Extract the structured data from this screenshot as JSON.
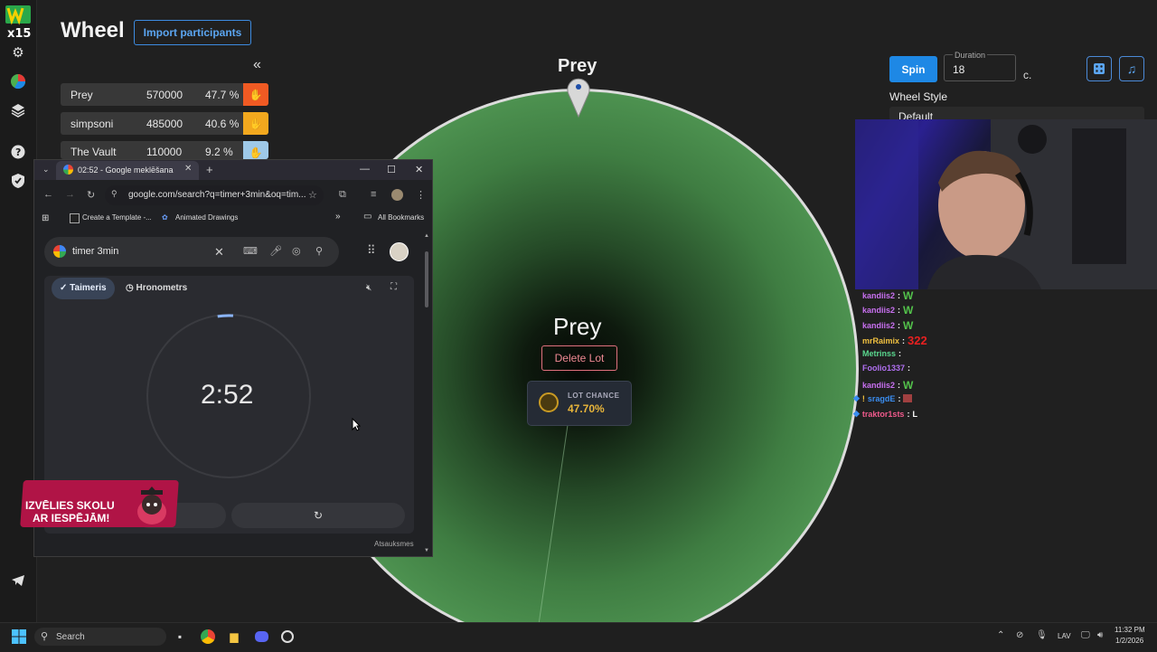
{
  "app": {
    "title": "Wheel",
    "import_label": "Import participants",
    "collapse_icon": "«"
  },
  "lots": [
    {
      "name": "Prey",
      "amount": "570000",
      "percent": "47.7 %",
      "color": "#f05a23"
    },
    {
      "name": "simpsoni",
      "amount": "485000",
      "percent": "40.6 %",
      "color": "#f2a81e"
    },
    {
      "name": "The Vault",
      "amount": "110000",
      "percent": "9.2 %",
      "color": "#9ec9e8"
    }
  ],
  "wheel": {
    "top_label": "Prey",
    "center_name": "Prey",
    "delete_label": "Delete Lot",
    "chance_label": "LOT CHANCE",
    "chance_value": "47.70%",
    "segment_color": "#5aa55d"
  },
  "controls": {
    "spin_label": "Spin",
    "duration_label": "Duration",
    "duration_value": "18",
    "duration_unit": "c.",
    "wheel_style_label": "Wheel Style",
    "wheel_style_value": "Default"
  },
  "chat": [
    {
      "user": "kandiis2",
      "msg": "W",
      "user_color": "#c870f0",
      "msg_color": "#53c24b"
    },
    {
      "user": "kandiis2",
      "msg": "W",
      "user_color": "#c870f0",
      "msg_color": "#53c24b"
    },
    {
      "user": "kandiis2",
      "msg": "W",
      "user_color": "#c870f0",
      "msg_color": "#53c24b"
    },
    {
      "user": "mrRaimix",
      "msg": "322",
      "user_color": "#f0c040",
      "msg_color": "#e82020"
    },
    {
      "user": "Metrinss",
      "msg": "",
      "user_color": "#5ad88f",
      "msg_color": "#ffffff"
    },
    {
      "user": "Foolio1337",
      "msg": "",
      "user_color": "#b070f0",
      "msg_color": "#ffffff"
    },
    {
      "user": "kandiis2",
      "msg": "W",
      "user_color": "#c870f0",
      "msg_color": "#53c24b"
    },
    {
      "user": "sragdE",
      "msg": "",
      "user_color": "#3a8df0",
      "msg_color": "#ffffff"
    },
    {
      "user": "traktor1sts",
      "msg": "L",
      "user_color": "#f05a8c",
      "msg_color": "#ffffff"
    }
  ],
  "browser": {
    "tab_title": "02:52 - Google meklēšana",
    "url": "google.com/search?q=timer+3min&oq=tim...",
    "bookmarks": [
      "Create a Template -...",
      "Animated Drawings"
    ],
    "all_bookmarks": "All Bookmarks",
    "search_query": "timer 3min",
    "timer_tab": "Taimeris",
    "stopwatch_tab": "Hronometrs",
    "timer_value": "2:52",
    "timer_progress": 0.044,
    "feedback": "Atsauksmes"
  },
  "promo": {
    "line1": "IZVĒLIES SKOLU",
    "line2": "AR IESPĒJĀM!"
  },
  "taskbar": {
    "search_placeholder": "Search",
    "language": "LAV",
    "time": "11:32 PM",
    "date": "1/2/2026"
  }
}
